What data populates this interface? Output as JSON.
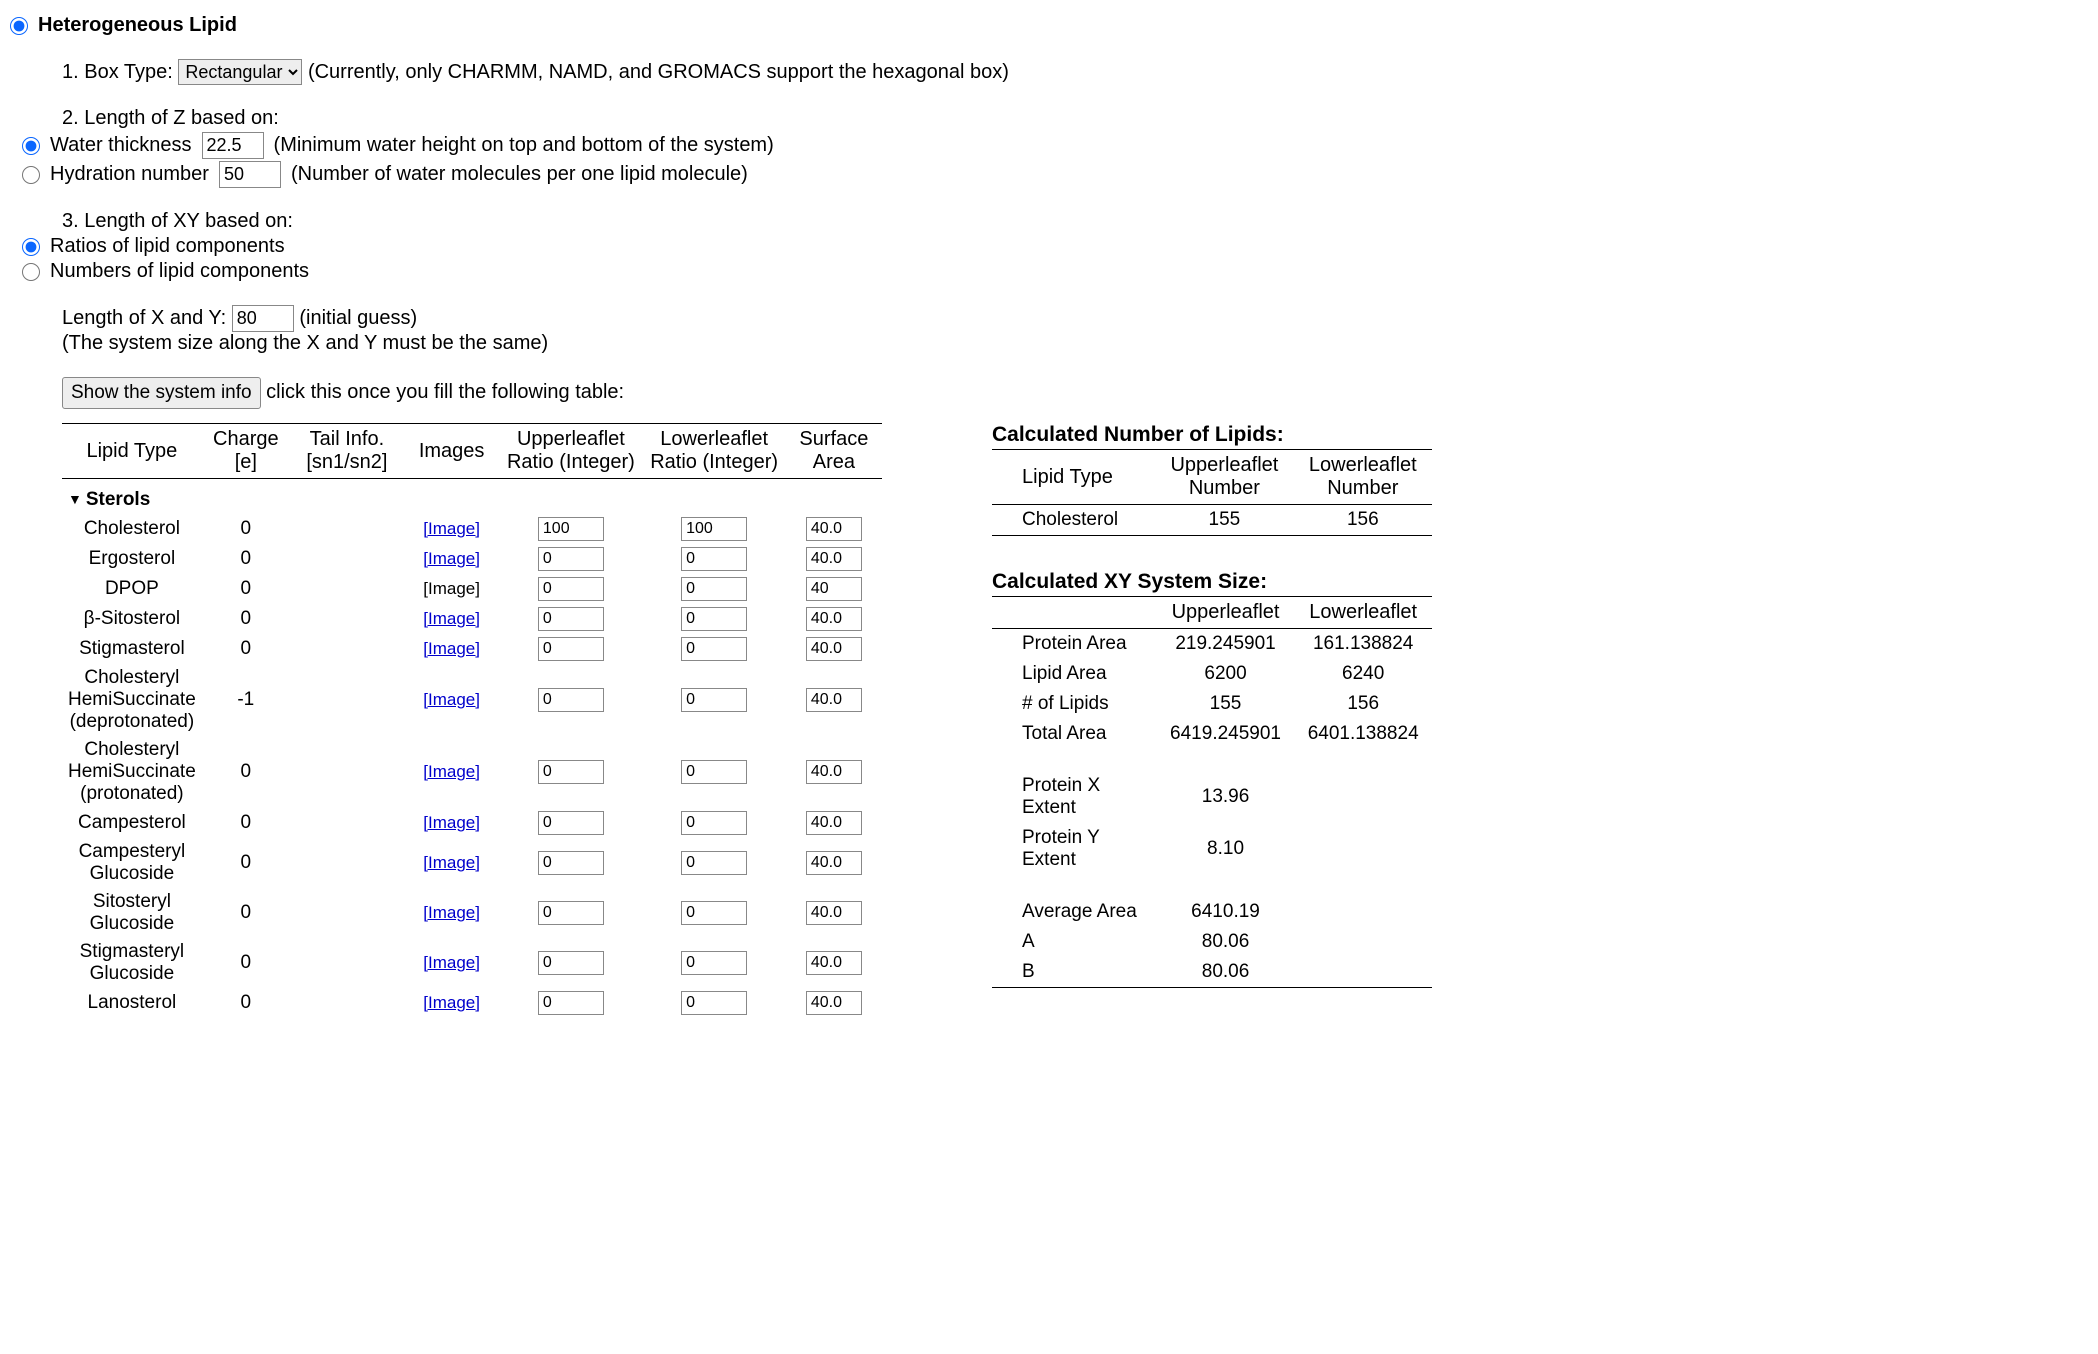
{
  "header": {
    "mode_label": "Heterogeneous Lipid"
  },
  "box": {
    "num": "1.",
    "label": "Box Type:",
    "selected": "Rectangular",
    "note": "(Currently, only CHARMM, NAMD, and GROMACS support the hexagonal box)"
  },
  "zlen": {
    "num": "2.",
    "label": "Length of Z based on:",
    "opt_water_label": "Water thickness",
    "opt_water_value": "22.5",
    "opt_water_note": "(Minimum water height on top and bottom of the system)",
    "opt_hyd_label": "Hydration number",
    "opt_hyd_value": "50",
    "opt_hyd_note": "(Number of water molecules per one lipid molecule)"
  },
  "xylen": {
    "num": "3.",
    "label": "Length of XY based on:",
    "opt_ratio_label": "Ratios of lipid components",
    "opt_number_label": "Numbers of lipid components"
  },
  "xysize": {
    "label": "Length of X and Y:",
    "value": "80",
    "note": "(initial guess)",
    "note2": "(The system size along the X and Y must be the same)"
  },
  "sysinfo": {
    "button": "Show the system info",
    "hint": "click this once you fill the following table:"
  },
  "table": {
    "headers": {
      "lipid_type": "Lipid Type",
      "charge": "Charge<br>[e]",
      "tail": "Tail Info.<br>[sn1/sn2]",
      "images": "Images",
      "upper": "Upperleaflet<br>Ratio (Integer)",
      "lower": "Lowerleaflet<br>Ratio (Integer)",
      "area": "Surface<br>Area"
    },
    "section": "Sterols",
    "rows": [
      {
        "name": "Cholesterol",
        "charge": "0",
        "tail": "",
        "img_link": true,
        "upper": "100",
        "lower": "100",
        "area": "40.0"
      },
      {
        "name": "Ergosterol",
        "charge": "0",
        "tail": "",
        "img_link": true,
        "upper": "0",
        "lower": "0",
        "area": "40.0"
      },
      {
        "name": "DPOP",
        "charge": "0",
        "tail": "",
        "img_link": false,
        "upper": "0",
        "lower": "0",
        "area": "40"
      },
      {
        "name": "β-Sitosterol",
        "charge": "0",
        "tail": "",
        "img_link": true,
        "upper": "0",
        "lower": "0",
        "area": "40.0"
      },
      {
        "name": "Stigmasterol",
        "charge": "0",
        "tail": "",
        "img_link": true,
        "upper": "0",
        "lower": "0",
        "area": "40.0"
      },
      {
        "name": "Cholesteryl<br>HemiSuccinate<br>(deprotonated)",
        "charge": "-1",
        "tail": "",
        "img_link": true,
        "upper": "0",
        "lower": "0",
        "area": "40.0"
      },
      {
        "name": "Cholesteryl<br>HemiSuccinate<br>(protonated)",
        "charge": "0",
        "tail": "",
        "img_link": true,
        "upper": "0",
        "lower": "0",
        "area": "40.0"
      },
      {
        "name": "Campesterol",
        "charge": "0",
        "tail": "",
        "img_link": true,
        "upper": "0",
        "lower": "0",
        "area": "40.0"
      },
      {
        "name": "Campesteryl<br>Glucoside",
        "charge": "0",
        "tail": "",
        "img_link": true,
        "upper": "0",
        "lower": "0",
        "area": "40.0"
      },
      {
        "name": "Sitosteryl<br>Glucoside",
        "charge": "0",
        "tail": "",
        "img_link": true,
        "upper": "0",
        "lower": "0",
        "area": "40.0"
      },
      {
        "name": "Stigmasteryl<br>Glucoside",
        "charge": "0",
        "tail": "",
        "img_link": true,
        "upper": "0",
        "lower": "0",
        "area": "40.0"
      },
      {
        "name": "Lanosterol",
        "charge": "0",
        "tail": "",
        "img_link": true,
        "upper": "0",
        "lower": "0",
        "area": "40.0"
      }
    ]
  },
  "calc_lipids": {
    "title": "Calculated Number of Lipids:",
    "headers": {
      "type": "Lipid Type",
      "upper": "Upperleaflet<br>Number",
      "lower": "Lowerleaflet<br>Number"
    },
    "rows": [
      {
        "name": "Cholesterol",
        "upper": "155",
        "lower": "156"
      }
    ]
  },
  "calc_xy": {
    "title": "Calculated XY System Size:",
    "headers": {
      "blank": "",
      "upper": "Upperleaflet",
      "lower": "Lowerleaflet"
    },
    "rows1": [
      {
        "label": "Protein Area",
        "upper": "219.245901",
        "lower": "161.138824"
      },
      {
        "label": "Lipid Area",
        "upper": "6200",
        "lower": "6240"
      },
      {
        "label": "# of Lipids",
        "upper": "155",
        "lower": "156"
      },
      {
        "label": "Total Area",
        "upper": "6419.245901",
        "lower": "6401.138824"
      }
    ],
    "rows2": [
      {
        "label": "Protein X Extent",
        "upper": "13.96",
        "lower": ""
      },
      {
        "label": "Protein Y Extent",
        "upper": "8.10",
        "lower": ""
      }
    ],
    "rows3": [
      {
        "label": "Average Area",
        "upper": "6410.19",
        "lower": ""
      },
      {
        "label": "A",
        "upper": "80.06",
        "lower": ""
      },
      {
        "label": "B",
        "upper": "80.06",
        "lower": ""
      }
    ]
  },
  "img_link_text": "[Image]"
}
